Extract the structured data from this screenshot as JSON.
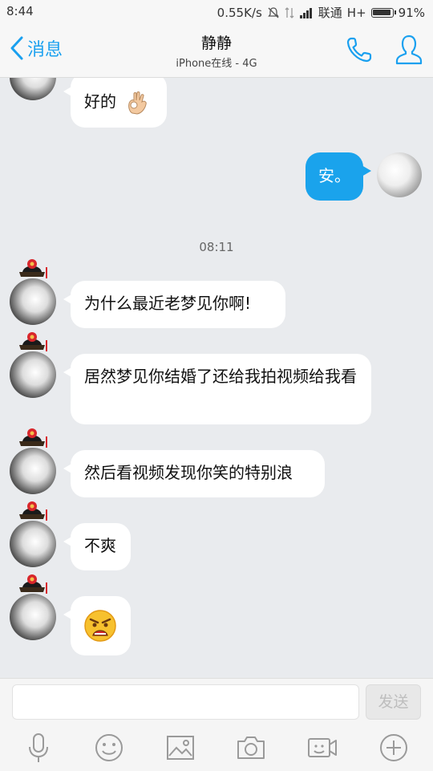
{
  "status_bar": {
    "time": "8:44",
    "network_speed": "0.55K/s",
    "carrier": "联通",
    "network_type": "H+",
    "battery": "91%"
  },
  "header": {
    "back_label": "消息",
    "contact_name": "静静",
    "contact_status": "iPhone在线 - 4G"
  },
  "messages": [
    {
      "side": "left",
      "text": "好的",
      "emoji": "ok-hand-emoji"
    },
    {
      "side": "right",
      "text": "安。"
    },
    {
      "type": "timestamp",
      "text": "08:11"
    },
    {
      "side": "left",
      "text": "为什么最近老梦见你啊!"
    },
    {
      "side": "left",
      "text": "居然梦见你结婚了还给我拍视频给我看"
    },
    {
      "side": "left",
      "text": "然后看视频发现你笑的特别浪"
    },
    {
      "side": "left",
      "text": "不爽"
    },
    {
      "side": "left",
      "emoji": "angry-face-emoji"
    }
  ],
  "composer": {
    "input_value": "",
    "send_label": "发送"
  },
  "toolbar_icons": [
    "microphone-icon",
    "smiley-icon",
    "image-icon",
    "camera-icon",
    "video-call-icon",
    "plus-icon"
  ],
  "colors": {
    "accent": "#1aa0ef",
    "sent_bubble": "#1aa3ec",
    "background": "#e9ebee"
  }
}
